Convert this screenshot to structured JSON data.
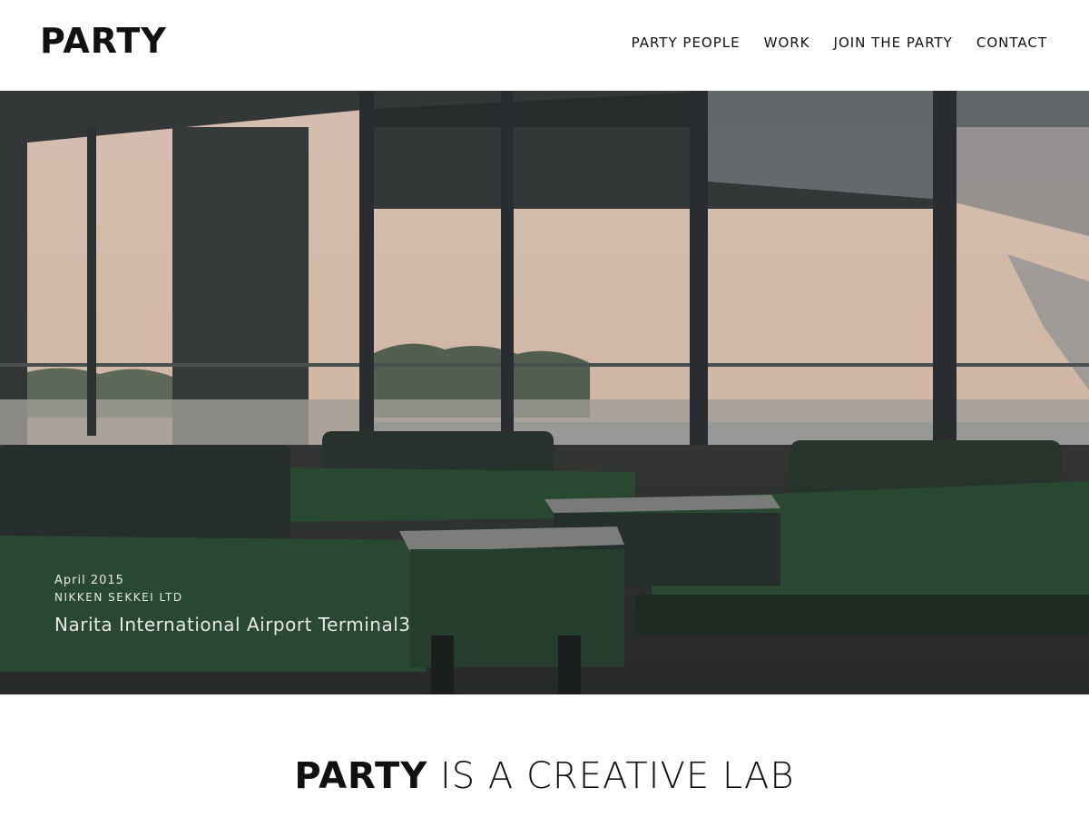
{
  "header": {
    "logo": "PARTY",
    "nav": [
      "PARTY PEOPLE",
      "WORK",
      "JOIN THE PARTY",
      "CONTACT"
    ]
  },
  "hero": {
    "date": "April 2015",
    "client": "NIKKEN SEKKEI LTD",
    "project": "Narita International Airport  Terminal3"
  },
  "tagline": {
    "brand": "PARTY",
    "rest": " IS A CREATIVE LAB"
  }
}
